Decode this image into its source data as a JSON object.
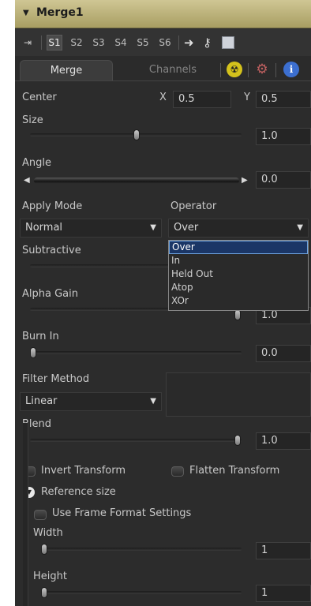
{
  "header": {
    "title": "Merge1"
  },
  "toolbar": {
    "slots": [
      "S1",
      "S2",
      "S3",
      "S4",
      "S5",
      "S6"
    ]
  },
  "tabs": {
    "merge": "Merge",
    "channels": "Channels"
  },
  "center": {
    "label": "Center",
    "x_label": "X",
    "x_value": "0.5",
    "y_label": "Y",
    "y_value": "0.5"
  },
  "size": {
    "label": "Size",
    "value": "1.0"
  },
  "angle": {
    "label": "Angle",
    "value": "0.0"
  },
  "apply_mode": {
    "label": "Apply Mode",
    "value": "Normal"
  },
  "operator": {
    "label": "Operator",
    "value": "Over",
    "options": [
      "Over",
      "In",
      "Held Out",
      "Atop",
      "XOr"
    ]
  },
  "subtractive": {
    "label": "Subtractive"
  },
  "alpha_gain": {
    "label": "Alpha Gain",
    "value": "1.0"
  },
  "burn_in": {
    "label": "Burn In",
    "value": "0.0"
  },
  "filter_method": {
    "label": "Filter Method",
    "value": "Linear"
  },
  "blend": {
    "label": "Blend",
    "value": "1.0"
  },
  "invert_transform": {
    "label": "Invert Transform"
  },
  "flatten_transform": {
    "label": "Flatten Transform"
  },
  "reference_size": {
    "label": "Reference size"
  },
  "use_frame_format": {
    "label": "Use Frame Format Settings"
  },
  "width": {
    "label": "Width",
    "value": "1"
  },
  "height": {
    "label": "Height",
    "value": "1"
  },
  "colors": {
    "title_bar": "#bdb27a",
    "panel_bg": "#2b2b2b",
    "selection": "#1b3666"
  }
}
